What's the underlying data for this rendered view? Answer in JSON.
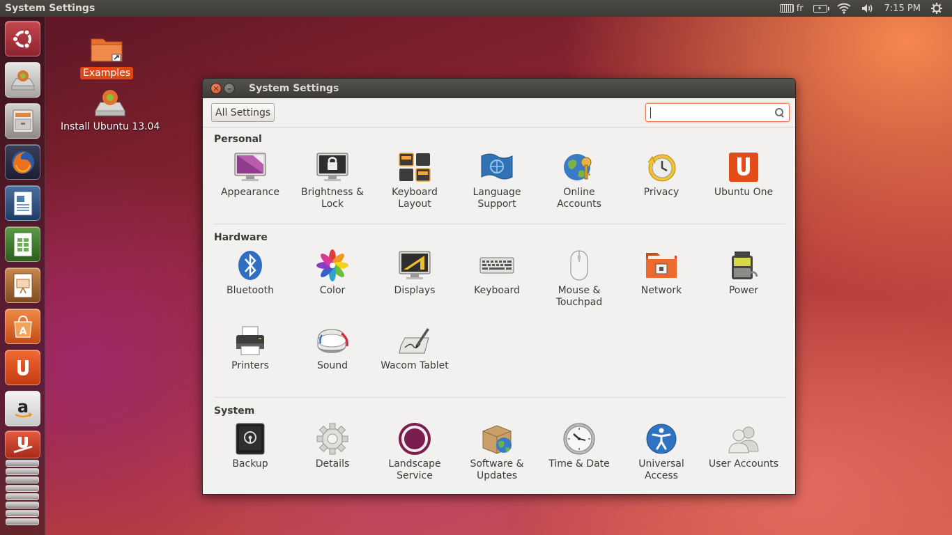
{
  "top_panel": {
    "title": "System Settings",
    "keyboard_layout": "fr",
    "clock": "7:15 PM"
  },
  "launcher": {
    "items": [
      "dash-home",
      "installer",
      "files",
      "firefox",
      "writer",
      "calc",
      "impress",
      "software-center",
      "ubuntu-one",
      "amazon",
      "update-manager"
    ]
  },
  "desktop": {
    "icons": [
      {
        "label": "Examples"
      },
      {
        "label": "Install Ubuntu 13.04"
      }
    ]
  },
  "window": {
    "title": "System Settings",
    "toolbar": {
      "all_settings_label": "All Settings",
      "search_value": "",
      "search_placeholder": ""
    },
    "sections": [
      {
        "title": "Personal",
        "items": [
          {
            "label": "Appearance",
            "icon": "appearance-icon"
          },
          {
            "label": "Brightness &\nLock",
            "icon": "brightness-lock-icon"
          },
          {
            "label": "Keyboard\nLayout",
            "icon": "keyboard-layout-icon"
          },
          {
            "label": "Language\nSupport",
            "icon": "language-support-icon"
          },
          {
            "label": "Online\nAccounts",
            "icon": "online-accounts-icon"
          },
          {
            "label": "Privacy",
            "icon": "privacy-icon"
          },
          {
            "label": "Ubuntu One",
            "icon": "ubuntu-one-icon"
          }
        ]
      },
      {
        "title": "Hardware",
        "items": [
          {
            "label": "Bluetooth",
            "icon": "bluetooth-icon"
          },
          {
            "label": "Color",
            "icon": "color-icon"
          },
          {
            "label": "Displays",
            "icon": "displays-icon"
          },
          {
            "label": "Keyboard",
            "icon": "keyboard-icon"
          },
          {
            "label": "Mouse &\nTouchpad",
            "icon": "mouse-icon"
          },
          {
            "label": "Network",
            "icon": "network-icon"
          },
          {
            "label": "Power",
            "icon": "power-icon"
          },
          {
            "label": "Printers",
            "icon": "printer-icon"
          },
          {
            "label": "Sound",
            "icon": "sound-icon"
          },
          {
            "label": "Wacom Tablet",
            "icon": "wacom-tablet-icon"
          }
        ]
      },
      {
        "title": "System",
        "items": [
          {
            "label": "Backup",
            "icon": "backup-icon"
          },
          {
            "label": "Details",
            "icon": "details-icon"
          },
          {
            "label": "Landscape\nService",
            "icon": "landscape-icon"
          },
          {
            "label": "Software &\nUpdates",
            "icon": "software-updates-icon"
          },
          {
            "label": "Time & Date",
            "icon": "clock-icon"
          },
          {
            "label": "Universal\nAccess",
            "icon": "universal-access-icon"
          },
          {
            "label": "User Accounts",
            "icon": "user-accounts-icon"
          }
        ]
      }
    ]
  },
  "colors": {
    "accent": "#dd4814",
    "panel": "#3c3b37",
    "window_bg": "#f2f1f0",
    "text": "#3c3b37"
  }
}
